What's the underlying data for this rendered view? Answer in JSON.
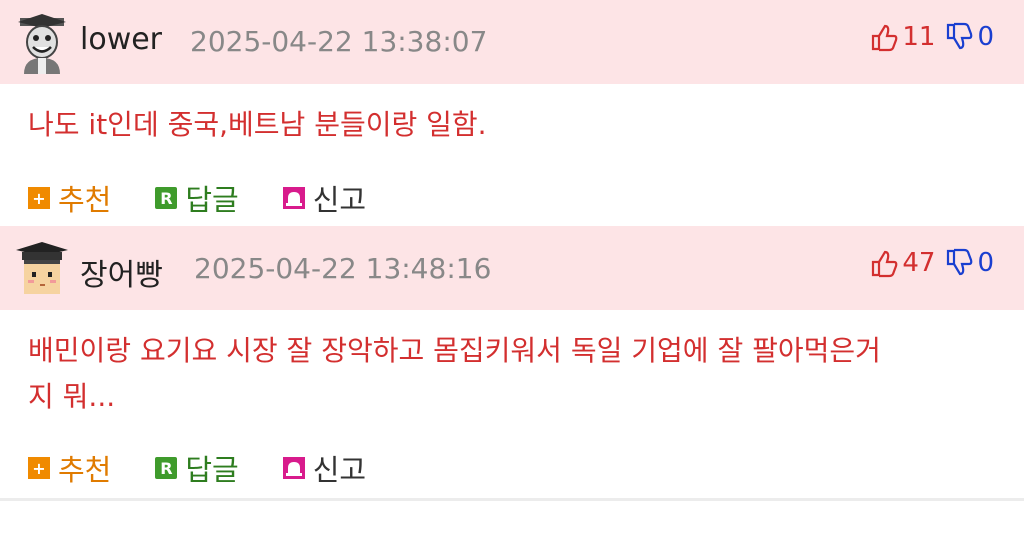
{
  "comments": [
    {
      "author": "lower",
      "date": "2025-04-22 13:38:07",
      "upvotes": "11",
      "downvotes": "0",
      "body_lines": [
        "나도 it인데 중국,베트남 분들이랑 일함."
      ],
      "avatar_icon": "grinning-student-avatar-icon",
      "actions": {
        "recommend": "추천",
        "reply": "답글",
        "report": "신고"
      }
    },
    {
      "author": "장어빵",
      "date": "2025-04-22 13:48:16",
      "upvotes": "47",
      "downvotes": "0",
      "body_lines": [
        "배민이랑 요기요 시장 잘 장악하고 몸집키워서 독일 기업에 잘 팔아먹은거",
        "지 뭐..."
      ],
      "avatar_icon": "graduate-cap-avatar-icon",
      "actions": {
        "recommend": "추천",
        "reply": "답글",
        "report": "신고"
      }
    }
  ],
  "colors": {
    "header_bg": "#fde4e6",
    "body_text": "#d32f2f",
    "upvote": "#d32f2f",
    "downvote": "#1a3fd0",
    "recommend": "#e07b00",
    "reply": "#2e7d1f",
    "report_icon": "#d81b8c"
  }
}
